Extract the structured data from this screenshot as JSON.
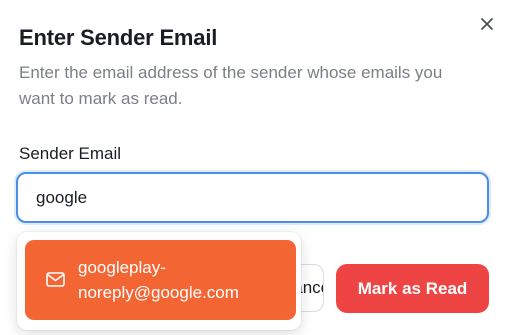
{
  "dialog": {
    "title": "Enter Sender Email",
    "description": "Enter the email address of the sender whose emails you want to mark as read.",
    "close_icon": "close-icon"
  },
  "form": {
    "label": "Sender Email",
    "input_value": "google"
  },
  "suggestions": [
    {
      "icon": "mail-icon",
      "text": "googleplay-noreply@google.com"
    }
  ],
  "actions": {
    "cancel_label": "Cancel",
    "mark_read_label": "Mark as Read"
  },
  "colors": {
    "focus_border": "#4a8ee8",
    "suggestion_highlight": "#f46534",
    "primary_button": "#ef4444"
  }
}
